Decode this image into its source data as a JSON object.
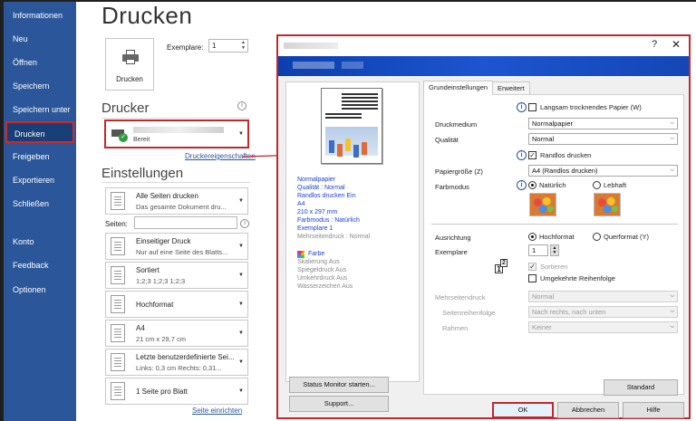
{
  "nav": {
    "items": [
      "Informationen",
      "Neu",
      "Öffnen",
      "Speichern",
      "Speichern unter",
      "Drucken",
      "Freigeben",
      "Exportieren",
      "Schließen",
      "Konto",
      "Feedback",
      "Optionen"
    ],
    "active": "Drucken"
  },
  "page": {
    "title": "Drucken"
  },
  "print": {
    "button_label": "Drucken",
    "copies_label": "Exemplare:",
    "copies_value": "1"
  },
  "printer": {
    "section_title": "Drucker",
    "status": "Bereit",
    "properties_link": "Druckereigenschaften"
  },
  "settings": {
    "section_title": "Einstellungen",
    "pages_label": "Seiten:",
    "items": [
      {
        "line1": "Alle Seiten drucken",
        "line2": "Das gesamte Dokument dru..."
      },
      {
        "line1": "Einseitiger Druck",
        "line2": "Nur auf eine Seite des Blatts..."
      },
      {
        "line1": "Sortiert",
        "line2": "1;2;3   1;2;3   1;2;3"
      },
      {
        "line1": "Hochformat",
        "line2": ""
      },
      {
        "line1": "A4",
        "line2": "21 cm x 29,7 cm"
      },
      {
        "line1": "Letzte benutzerdefinierte Sei...",
        "line2": "Links: 0,3 cm   Rechts: 0,31..."
      },
      {
        "line1": "1 Seite pro Blatt",
        "line2": ""
      }
    ],
    "page_setup_link": "Seite einrichten"
  },
  "dialog": {
    "help": "?",
    "close": "✕",
    "preview_lines": [
      "Normalpapier",
      "Qualität : Normal",
      "Randlos drucken Ein",
      "A4",
      "210 x 297 mm",
      "Farbmodus : Natürlich",
      "Exemplare 1"
    ],
    "preview_gray_line": "Mehrseitendruck : Normal",
    "preview_color": "Farbe",
    "preview_gray_lines": [
      "Skalierung Aus",
      "Spiegeldruck Aus",
      "Umkehrdruck Aus",
      "Wasserzeichen Aus"
    ],
    "tabs": [
      "Grundeinstellungen",
      "Erweitert"
    ],
    "slow_dry": "Langsam trocknendes Papier (W)",
    "media_label": "Druckmedium",
    "media_value": "Normalpapier",
    "quality_label": "Qualität",
    "quality_value": "Normal",
    "borderless": "Randlos drucken",
    "paper_size_label": "Papiergröße (Z)",
    "paper_size_value": "A4 (Randlos drucken)",
    "color_mode_label": "Farbmodus",
    "color_natural": "Natürlich",
    "color_vivid": "Lebhaft",
    "orientation_label": "Ausrichtung",
    "portrait": "Hochformat",
    "landscape": "Querformat (Y)",
    "copies_label": "Exemplare",
    "copies_value": "1",
    "collate": "Sortieren",
    "reverse": "Umgekehrte Reihenfolge",
    "multipage_label": "Mehrseitendruck",
    "multipage_value": "Normal",
    "page_order_label": "Seitenreihenfolge",
    "page_order_value": "Nach rechts, nach unten",
    "frame_label": "Rahmen",
    "frame_value": "Keiner",
    "standard_button": "Standard",
    "status_monitor_button": "Status Monitor starten...",
    "support_button": "Support...",
    "ok_button": "OK",
    "cancel_button": "Abbrechen",
    "help_button": "Hilfe"
  },
  "colors": {
    "nav_bg": "#2b579a",
    "highlight": "#c0282e",
    "banner": "#1446b6"
  }
}
